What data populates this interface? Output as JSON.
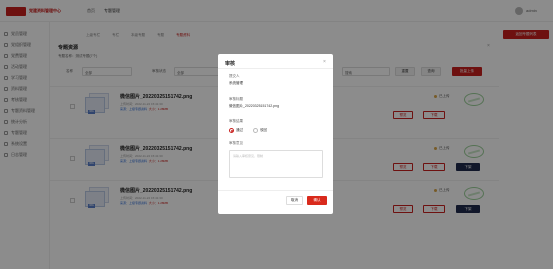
{
  "app": {
    "title": "党建资料管理中心",
    "header_home": "首页",
    "header_title": "专题管理",
    "user_name": "admin"
  },
  "sidebar": {
    "items": [
      {
        "label": "党员管理"
      },
      {
        "label": "党组织管理"
      },
      {
        "label": "党费管理"
      },
      {
        "label": "活动管理"
      },
      {
        "label": "学习管理"
      },
      {
        "label": "资料管理"
      },
      {
        "label": "考核管理"
      },
      {
        "label": "专题资料管理"
      },
      {
        "label": "统计分析"
      },
      {
        "label": "专题管理"
      },
      {
        "label": "系统设置"
      },
      {
        "label": "日志管理"
      }
    ]
  },
  "breadcrumb": {
    "items": [
      "上级专栏",
      "专栏",
      "本级专题",
      "专题",
      "专题资料"
    ],
    "back_label": "返回专题列表"
  },
  "panel": {
    "title": "专题资源",
    "subtitle": "专题名称：测试专题(7个)",
    "close": "×",
    "filter": {
      "name_label": "名称",
      "name_value": "全部",
      "status_label": "审核状态",
      "status_value": "全部",
      "search_placeholder": "搜索",
      "reset_label": "重置",
      "query_label": "查询",
      "upload_label": "批量上传"
    }
  },
  "files": [
    {
      "name": "微信图片_20220325151742.png",
      "meta1": "上传时间：2022-11-22 15:41:30",
      "meta2_a": "来源：上级专题资料",
      "meta2_b": "大小：1.28MB",
      "status": "已上传",
      "actions": [
        "预览",
        "下载"
      ]
    },
    {
      "name": "微信图片_20220325151742.png",
      "meta1": "上传时间：2022-11-22 15:41:30",
      "meta2_a": "来源：上级专题资料",
      "meta2_b": "大小：1.28MB",
      "status": "已上传",
      "actions": [
        "预览",
        "下载",
        "下架"
      ]
    },
    {
      "name": "微信图片_20220325151742.png",
      "meta1": "上传时间：2022-11-22 15:41:30",
      "meta2_a": "来源：上级专题资料",
      "meta2_b": "大小：1.28MB",
      "status": "已上传",
      "actions": [
        "预览",
        "下载",
        "下架"
      ]
    }
  ],
  "dialog": {
    "title": "审核",
    "close": "×",
    "submitter_label": "提交人",
    "submitter_value": "系统管理",
    "file_label": "审核标题",
    "file_value": "微信图片_20220325151742.png",
    "result_label": "审核结果",
    "option_pass": "通过",
    "option_reject": "驳回",
    "opinion_label": "审核意见",
    "opinion_placeholder": "请输入审核意见，限制",
    "cancel_label": "取消",
    "ok_label": "确认"
  },
  "colors": {
    "brand": "#c8201e",
    "dark_button": "#1f2b4d",
    "overlay": "rgba(0,0,0,0.45)"
  }
}
